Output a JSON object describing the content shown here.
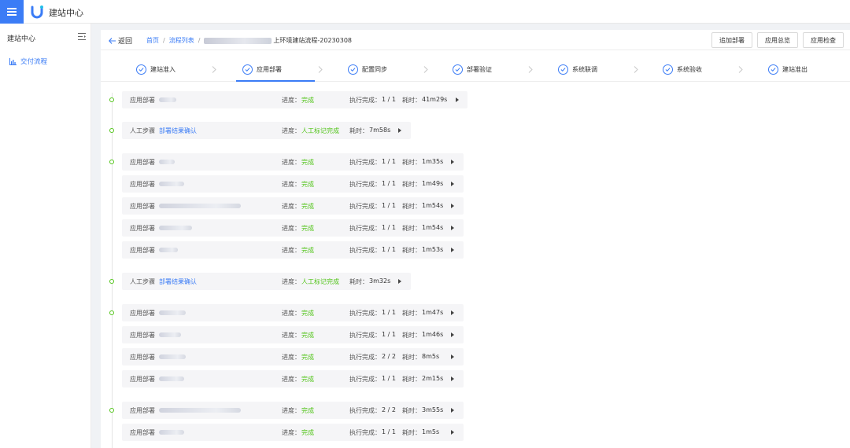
{
  "app": {
    "title": "建站中心"
  },
  "sidebar": {
    "header": "建站中心",
    "items": [
      {
        "label": "交付流程",
        "icon": "bar-chart-icon"
      }
    ]
  },
  "header": {
    "back_label": "返回",
    "breadcrumb": {
      "home": "首页",
      "list": "流程列表",
      "current": "上环境建站流程-20230308"
    },
    "buttons": [
      "追加部署",
      "应用总览",
      "应用检查"
    ]
  },
  "steps": [
    "建站准入",
    "应用部署",
    "配置同步",
    "部署验证",
    "系统联调",
    "系统验收",
    "建站准出"
  ],
  "active_step": "应用部署",
  "rows": [
    {
      "type": "应用部署",
      "name": "",
      "progress_label": "进度：",
      "progress": "完成",
      "exec_label": "执行完成：",
      "exec": "1 / 1",
      "time_label": "耗时：",
      "time": "41m29s"
    },
    {
      "type": "人工步骤",
      "name": "部署结果确认",
      "progress_label": "进度：",
      "progress": "人工标记完成",
      "time_label": "耗时：",
      "time": "7m58s"
    },
    {
      "type": "应用部署",
      "name": "",
      "progress_label": "进度：",
      "progress": "完成",
      "exec_label": "执行完成：",
      "exec": "1 / 1",
      "time_label": "耗时：",
      "time": "1m35s"
    },
    {
      "type": "应用部署",
      "name": "",
      "progress_label": "进度：",
      "progress": "完成",
      "exec_label": "执行完成：",
      "exec": "1 / 1",
      "time_label": "耗时：",
      "time": "1m49s"
    },
    {
      "type": "应用部署",
      "name": "",
      "progress_label": "进度：",
      "progress": "完成",
      "exec_label": "执行完成：",
      "exec": "1 / 1",
      "time_label": "耗时：",
      "time": "1m54s"
    },
    {
      "type": "应用部署",
      "name": "",
      "progress_label": "进度：",
      "progress": "完成",
      "exec_label": "执行完成：",
      "exec": "1 / 1",
      "time_label": "耗时：",
      "time": "1m54s"
    },
    {
      "type": "应用部署",
      "name": "",
      "progress_label": "进度：",
      "progress": "完成",
      "exec_label": "执行完成：",
      "exec": "1 / 1",
      "time_label": "耗时：",
      "time": "1m53s"
    },
    {
      "type": "人工步骤",
      "name": "部署结果确认",
      "progress_label": "进度：",
      "progress": "人工标记完成",
      "time_label": "耗时：",
      "time": "3m32s"
    },
    {
      "type": "应用部署",
      "name": "",
      "progress_label": "进度：",
      "progress": "完成",
      "exec_label": "执行完成：",
      "exec": "1 / 1",
      "time_label": "耗时：",
      "time": "1m47s"
    },
    {
      "type": "应用部署",
      "name": "",
      "progress_label": "进度：",
      "progress": "完成",
      "exec_label": "执行完成：",
      "exec": "1 / 1",
      "time_label": "耗时：",
      "time": "1m46s"
    },
    {
      "type": "应用部署",
      "name": "",
      "progress_label": "进度：",
      "progress": "完成",
      "exec_label": "执行完成：",
      "exec": "2 / 2",
      "time_label": "耗时：",
      "time": "8m5s"
    },
    {
      "type": "应用部署",
      "name": "",
      "progress_label": "进度：",
      "progress": "完成",
      "exec_label": "执行完成：",
      "exec": "1 / 1",
      "time_label": "耗时：",
      "time": "2m15s"
    },
    {
      "type": "应用部署",
      "name": "",
      "progress_label": "进度：",
      "progress": "完成",
      "exec_label": "执行完成：",
      "exec": "2 / 2",
      "time_label": "耗时：",
      "time": "3m55s"
    },
    {
      "type": "应用部署",
      "name": "",
      "progress_label": "进度：",
      "progress": "完成",
      "exec_label": "执行完成：",
      "exec": "1 / 1",
      "time_label": "耗时：",
      "time": "1m5s"
    }
  ],
  "colors": {
    "accent": "#3b7cf6",
    "success": "#52c41a"
  }
}
